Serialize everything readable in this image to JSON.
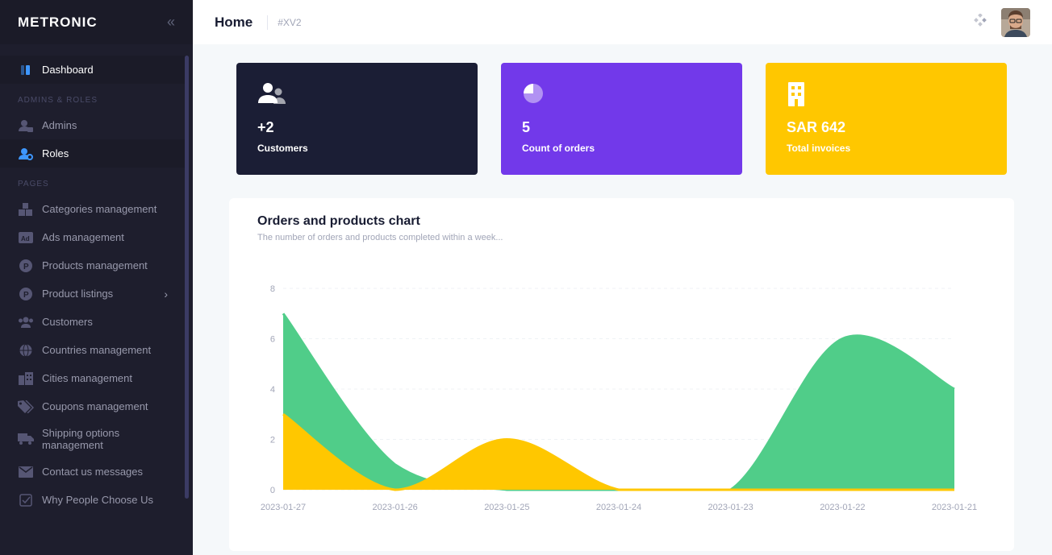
{
  "brand": {
    "name": "METRONIC"
  },
  "sidebar": {
    "dashboard": "Dashboard",
    "section_admins": "ADMINS & ROLES",
    "admins": "Admins",
    "roles": "Roles",
    "section_pages": "PAGES",
    "items": [
      {
        "label": "Categories management",
        "icon": "boxes-icon"
      },
      {
        "label": "Ads management",
        "icon": "ad-icon"
      },
      {
        "label": "Products management",
        "icon": "p-circle-icon"
      },
      {
        "label": "Product listings",
        "icon": "p-circle-icon"
      },
      {
        "label": "Customers",
        "icon": "users-icon"
      },
      {
        "label": "Countries management",
        "icon": "globe-icon"
      },
      {
        "label": "Cities management",
        "icon": "city-icon"
      },
      {
        "label": "Coupons management",
        "icon": "tags-icon"
      },
      {
        "label": "Shipping options management",
        "icon": "truck-icon"
      },
      {
        "label": "Contact us messages",
        "icon": "mail-icon"
      },
      {
        "label": "Why People Choose Us",
        "icon": "check-square-icon"
      }
    ]
  },
  "header": {
    "title": "Home",
    "crumb": "#XV2"
  },
  "stats": [
    {
      "value": "+2",
      "label": "Customers",
      "color": "#1b1e35",
      "icon": "users-icon"
    },
    {
      "value": "5",
      "label": "Count of orders",
      "color": "#7239ea",
      "icon": "pie-icon"
    },
    {
      "value": "SAR 642",
      "label": "Total invoices",
      "color": "#ffc700",
      "icon": "building-icon"
    }
  ],
  "chart": {
    "title": "Orders and products chart",
    "subtitle": "The number of orders and products completed within a week..."
  },
  "chart_data": {
    "type": "area",
    "categories": [
      "2023-01-27",
      "2023-01-26",
      "2023-01-25",
      "2023-01-24",
      "2023-01-23",
      "2023-01-22",
      "2023-01-21"
    ],
    "series": [
      {
        "values": [
          7,
          1,
          0,
          0,
          0,
          6,
          4
        ],
        "color": "#50cd89"
      },
      {
        "values": [
          3,
          0,
          2,
          0,
          0,
          0,
          0
        ],
        "color": "#ffc700"
      }
    ],
    "ylim": [
      0,
      8
    ],
    "yticks": [
      0,
      2,
      4,
      6,
      8
    ],
    "grid": true
  }
}
